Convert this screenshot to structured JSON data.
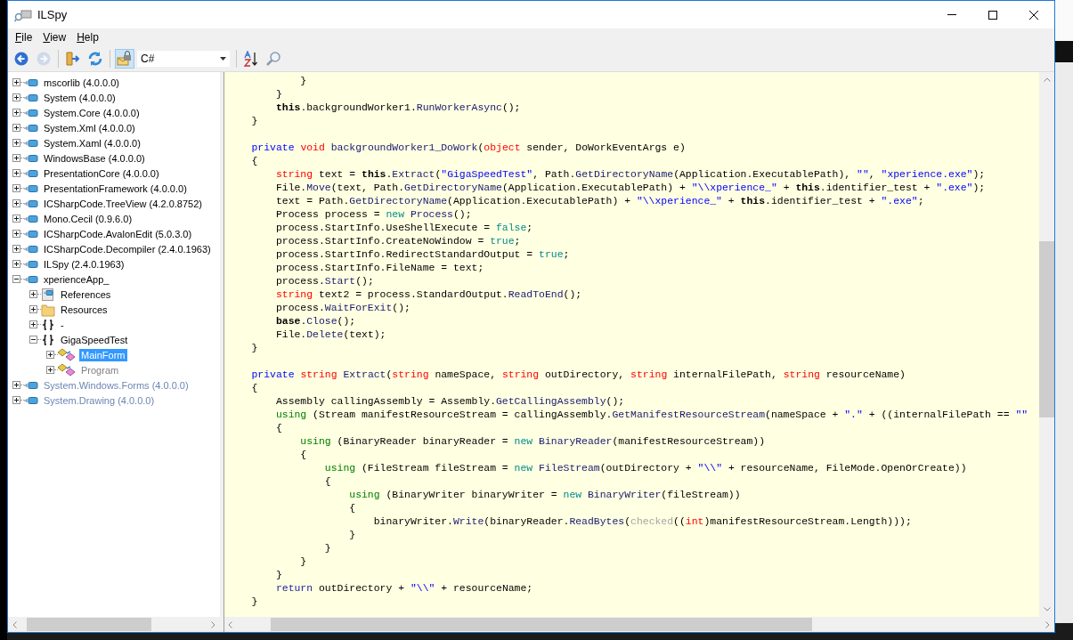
{
  "window": {
    "title": "ILSpy"
  },
  "menu": [
    {
      "label": "File"
    },
    {
      "label": "View"
    },
    {
      "label": "Help"
    }
  ],
  "toolbar": [
    {
      "kind": "back",
      "disabled": false
    },
    {
      "kind": "forward",
      "disabled": true
    },
    {
      "kind": "separator"
    },
    {
      "kind": "open",
      "disabled": false
    },
    {
      "kind": "reload",
      "disabled": false
    },
    {
      "kind": "separator"
    },
    {
      "kind": "lock",
      "disabled": false,
      "selected": true
    },
    {
      "kind": "language",
      "value": "C#"
    },
    {
      "kind": "separator"
    },
    {
      "kind": "sort",
      "disabled": false
    },
    {
      "kind": "search",
      "disabled": false
    }
  ],
  "tree": {
    "items": [
      {
        "kind": "assembly",
        "label": "mscorlib (4.0.0.0)",
        "expanded": false,
        "grayed": false,
        "selected": false
      },
      {
        "kind": "assembly",
        "label": "System (4.0.0.0)",
        "expanded": false,
        "grayed": false,
        "selected": false
      },
      {
        "kind": "assembly",
        "label": "System.Core (4.0.0.0)",
        "expanded": false,
        "grayed": false,
        "selected": false
      },
      {
        "kind": "assembly",
        "label": "System.Xml (4.0.0.0)",
        "expanded": false,
        "grayed": false,
        "selected": false
      },
      {
        "kind": "assembly",
        "label": "System.Xaml (4.0.0.0)",
        "expanded": false,
        "grayed": false,
        "selected": false
      },
      {
        "kind": "assembly",
        "label": "WindowsBase (4.0.0.0)",
        "expanded": false,
        "grayed": false,
        "selected": false
      },
      {
        "kind": "assembly",
        "label": "PresentationCore (4.0.0.0)",
        "expanded": false,
        "grayed": false,
        "selected": false
      },
      {
        "kind": "assembly",
        "label": "PresentationFramework (4.0.0.0)",
        "expanded": false,
        "grayed": false,
        "selected": false
      },
      {
        "kind": "assembly",
        "label": "ICSharpCode.TreeView (4.2.0.8752)",
        "expanded": false,
        "grayed": false,
        "selected": false
      },
      {
        "kind": "assembly",
        "label": "Mono.Cecil (0.9.6.0)",
        "expanded": false,
        "grayed": false,
        "selected": false
      },
      {
        "kind": "assembly",
        "label": "ICSharpCode.AvalonEdit (5.0.3.0)",
        "expanded": false,
        "grayed": false,
        "selected": false
      },
      {
        "kind": "assembly",
        "label": "ICSharpCode.Decompiler (2.4.0.1963)",
        "expanded": false,
        "grayed": false,
        "selected": false
      },
      {
        "kind": "assembly",
        "label": "ILSpy (2.4.0.1963)",
        "expanded": false,
        "grayed": false,
        "selected": false
      },
      {
        "kind": "assembly",
        "label": "xperienceApp_",
        "expanded": true,
        "grayed": false,
        "selected": false,
        "children": [
          {
            "kind": "references",
            "label": "References",
            "expanded": false,
            "grayed": false,
            "selected": false
          },
          {
            "kind": "folder",
            "label": "Resources",
            "expanded": false,
            "grayed": false,
            "selected": false
          },
          {
            "kind": "namespace",
            "label": "-",
            "expanded": false,
            "grayed": false,
            "selected": false
          },
          {
            "kind": "namespace",
            "label": "GigaSpeedTest",
            "expanded": true,
            "grayed": false,
            "selected": false,
            "children": [
              {
                "kind": "class",
                "label": "MainForm",
                "expanded": false,
                "grayed": false,
                "selected": true
              },
              {
                "kind": "class",
                "label": "Program",
                "expanded": false,
                "grayed": true,
                "selected": false
              }
            ]
          }
        ]
      },
      {
        "kind": "assembly",
        "label": "System.Windows.Forms (4.0.0.0)",
        "expanded": false,
        "grayed": true,
        "selected": false
      },
      {
        "kind": "assembly",
        "label": "System.Drawing (4.0.0.0)",
        "expanded": false,
        "grayed": true,
        "selected": false
      }
    ]
  },
  "code_lines": [
    {
      "kind": "code",
      "tokens": [
        {
          "kind": "plain",
          "text": "            }"
        }
      ]
    },
    {
      "kind": "code",
      "tokens": [
        {
          "kind": "plain",
          "text": "        }"
        }
      ]
    },
    {
      "kind": "code",
      "tokens": [
        {
          "kind": "bold",
          "text": "        this"
        },
        {
          "kind": "plain",
          "text": ".backgroundWorker1."
        },
        {
          "kind": "method",
          "text": "RunWorkerAsync"
        },
        {
          "kind": "plain",
          "text": "();"
        }
      ]
    },
    {
      "kind": "code",
      "tokens": [
        {
          "kind": "plain",
          "text": "    }"
        }
      ]
    },
    {
      "kind": "blank"
    },
    {
      "kind": "code",
      "tokens": [
        {
          "kind": "keyword",
          "text": "    private "
        },
        {
          "kind": "type",
          "text": "void "
        },
        {
          "kind": "method",
          "text": "backgroundWorker1_DoWork"
        },
        {
          "kind": "plain",
          "text": "("
        },
        {
          "kind": "type",
          "text": "object"
        },
        {
          "kind": "plain",
          "text": " sender, DoWorkEventArgs e)"
        }
      ]
    },
    {
      "kind": "code",
      "tokens": [
        {
          "kind": "plain",
          "text": "    {"
        }
      ]
    },
    {
      "kind": "code",
      "tokens": [
        {
          "kind": "type",
          "text": "        string"
        },
        {
          "kind": "plain",
          "text": " text = "
        },
        {
          "kind": "bold",
          "text": "this"
        },
        {
          "kind": "plain",
          "text": "."
        },
        {
          "kind": "method",
          "text": "Extract"
        },
        {
          "kind": "plain",
          "text": "("
        },
        {
          "kind": "string",
          "text": "\"GigaSpeedTest\""
        },
        {
          "kind": "plain",
          "text": ", Path."
        },
        {
          "kind": "method",
          "text": "GetDirectoryName"
        },
        {
          "kind": "plain",
          "text": "(Application.ExecutablePath), "
        },
        {
          "kind": "string",
          "text": "\"\""
        },
        {
          "kind": "plain",
          "text": ", "
        },
        {
          "kind": "string",
          "text": "\"xperience.exe\""
        },
        {
          "kind": "plain",
          "text": ");"
        }
      ]
    },
    {
      "kind": "code",
      "tokens": [
        {
          "kind": "plain",
          "text": "        File."
        },
        {
          "kind": "method",
          "text": "Move"
        },
        {
          "kind": "plain",
          "text": "(text, Path."
        },
        {
          "kind": "method",
          "text": "GetDirectoryName"
        },
        {
          "kind": "plain",
          "text": "(Application.ExecutablePath) + "
        },
        {
          "kind": "string",
          "text": "\"\\\\xperience_\""
        },
        {
          "kind": "plain",
          "text": " + "
        },
        {
          "kind": "bold",
          "text": "this"
        },
        {
          "kind": "plain",
          "text": ".identifier_test + "
        },
        {
          "kind": "string",
          "text": "\".exe\""
        },
        {
          "kind": "plain",
          "text": ");"
        }
      ]
    },
    {
      "kind": "code",
      "tokens": [
        {
          "kind": "plain",
          "text": "        text = Path."
        },
        {
          "kind": "method",
          "text": "GetDirectoryName"
        },
        {
          "kind": "plain",
          "text": "(Application.ExecutablePath) + "
        },
        {
          "kind": "string",
          "text": "\"\\\\xperience_\""
        },
        {
          "kind": "plain",
          "text": " + "
        },
        {
          "kind": "bold",
          "text": "this"
        },
        {
          "kind": "plain",
          "text": ".identifier_test + "
        },
        {
          "kind": "string",
          "text": "\".exe\""
        },
        {
          "kind": "plain",
          "text": ";"
        }
      ]
    },
    {
      "kind": "code",
      "tokens": [
        {
          "kind": "plain",
          "text": "        Process process = "
        },
        {
          "kind": "literal",
          "text": "new "
        },
        {
          "kind": "method",
          "text": "Process"
        },
        {
          "kind": "plain",
          "text": "();"
        }
      ]
    },
    {
      "kind": "code",
      "tokens": [
        {
          "kind": "plain",
          "text": "        process.StartInfo.UseShellExecute = "
        },
        {
          "kind": "literal",
          "text": "false"
        },
        {
          "kind": "plain",
          "text": ";"
        }
      ]
    },
    {
      "kind": "code",
      "tokens": [
        {
          "kind": "plain",
          "text": "        process.StartInfo.CreateNoWindow = "
        },
        {
          "kind": "literal",
          "text": "true"
        },
        {
          "kind": "plain",
          "text": ";"
        }
      ]
    },
    {
      "kind": "code",
      "tokens": [
        {
          "kind": "plain",
          "text": "        process.StartInfo.RedirectStandardOutput = "
        },
        {
          "kind": "literal",
          "text": "true"
        },
        {
          "kind": "plain",
          "text": ";"
        }
      ]
    },
    {
      "kind": "code",
      "tokens": [
        {
          "kind": "plain",
          "text": "        process.StartInfo.FileName = text;"
        }
      ]
    },
    {
      "kind": "code",
      "tokens": [
        {
          "kind": "plain",
          "text": "        process."
        },
        {
          "kind": "method",
          "text": "Start"
        },
        {
          "kind": "plain",
          "text": "();"
        }
      ]
    },
    {
      "kind": "code",
      "tokens": [
        {
          "kind": "type",
          "text": "        string"
        },
        {
          "kind": "plain",
          "text": " text2 = process.StandardOutput."
        },
        {
          "kind": "method",
          "text": "ReadToEnd"
        },
        {
          "kind": "plain",
          "text": "();"
        }
      ]
    },
    {
      "kind": "code",
      "tokens": [
        {
          "kind": "plain",
          "text": "        process."
        },
        {
          "kind": "method",
          "text": "WaitForExit"
        },
        {
          "kind": "plain",
          "text": "();"
        }
      ]
    },
    {
      "kind": "code",
      "tokens": [
        {
          "kind": "bold",
          "text": "        base"
        },
        {
          "kind": "plain",
          "text": "."
        },
        {
          "kind": "method",
          "text": "Close"
        },
        {
          "kind": "plain",
          "text": "();"
        }
      ]
    },
    {
      "kind": "code",
      "tokens": [
        {
          "kind": "plain",
          "text": "        File."
        },
        {
          "kind": "method",
          "text": "Delete"
        },
        {
          "kind": "plain",
          "text": "(text);"
        }
      ]
    },
    {
      "kind": "code",
      "tokens": [
        {
          "kind": "plain",
          "text": "    }"
        }
      ]
    },
    {
      "kind": "blank"
    },
    {
      "kind": "code",
      "tokens": [
        {
          "kind": "keyword",
          "text": "    private "
        },
        {
          "kind": "type",
          "text": "string "
        },
        {
          "kind": "method",
          "text": "Extract"
        },
        {
          "kind": "plain",
          "text": "("
        },
        {
          "kind": "type",
          "text": "string"
        },
        {
          "kind": "plain",
          "text": " nameSpace, "
        },
        {
          "kind": "type",
          "text": "string"
        },
        {
          "kind": "plain",
          "text": " outDirectory, "
        },
        {
          "kind": "type",
          "text": "string"
        },
        {
          "kind": "plain",
          "text": " internalFilePath, "
        },
        {
          "kind": "type",
          "text": "string"
        },
        {
          "kind": "plain",
          "text": " resourceName)"
        }
      ]
    },
    {
      "kind": "code",
      "tokens": [
        {
          "kind": "plain",
          "text": "    {"
        }
      ]
    },
    {
      "kind": "code",
      "tokens": [
        {
          "kind": "plain",
          "text": "        Assembly callingAssembly = Assembly."
        },
        {
          "kind": "method",
          "text": "GetCallingAssembly"
        },
        {
          "kind": "plain",
          "text": "();"
        }
      ]
    },
    {
      "kind": "code",
      "tokens": [
        {
          "kind": "using",
          "text": "        using"
        },
        {
          "kind": "plain",
          "text": " (Stream manifestResourceStream = callingAssembly."
        },
        {
          "kind": "method",
          "text": "GetManifestResourceStream"
        },
        {
          "kind": "plain",
          "text": "(nameSpace + "
        },
        {
          "kind": "string",
          "text": "\".\""
        },
        {
          "kind": "plain",
          "text": " + ((internalFilePath == "
        },
        {
          "kind": "string",
          "text": "\"\""
        }
      ]
    },
    {
      "kind": "code",
      "tokens": [
        {
          "kind": "plain",
          "text": "        {"
        }
      ]
    },
    {
      "kind": "code",
      "tokens": [
        {
          "kind": "using",
          "text": "            using"
        },
        {
          "kind": "plain",
          "text": " (BinaryReader binaryReader = "
        },
        {
          "kind": "literal",
          "text": "new "
        },
        {
          "kind": "method",
          "text": "BinaryReader"
        },
        {
          "kind": "plain",
          "text": "(manifestResourceStream))"
        }
      ]
    },
    {
      "kind": "code",
      "tokens": [
        {
          "kind": "plain",
          "text": "            {"
        }
      ]
    },
    {
      "kind": "code",
      "tokens": [
        {
          "kind": "using",
          "text": "                using"
        },
        {
          "kind": "plain",
          "text": " (FileStream fileStream = "
        },
        {
          "kind": "literal",
          "text": "new "
        },
        {
          "kind": "method",
          "text": "FileStream"
        },
        {
          "kind": "plain",
          "text": "(outDirectory + "
        },
        {
          "kind": "string",
          "text": "\"\\\\\""
        },
        {
          "kind": "plain",
          "text": " + resourceName, FileMode.OpenOrCreate))"
        }
      ]
    },
    {
      "kind": "code",
      "tokens": [
        {
          "kind": "plain",
          "text": "                {"
        }
      ]
    },
    {
      "kind": "code",
      "tokens": [
        {
          "kind": "using",
          "text": "                    using"
        },
        {
          "kind": "plain",
          "text": " (BinaryWriter binaryWriter = "
        },
        {
          "kind": "literal",
          "text": "new "
        },
        {
          "kind": "method",
          "text": "BinaryWriter"
        },
        {
          "kind": "plain",
          "text": "(fileStream))"
        }
      ]
    },
    {
      "kind": "code",
      "tokens": [
        {
          "kind": "plain",
          "text": "                    {"
        }
      ]
    },
    {
      "kind": "code",
      "tokens": [
        {
          "kind": "plain",
          "text": "                        binaryWriter."
        },
        {
          "kind": "method",
          "text": "Write"
        },
        {
          "kind": "plain",
          "text": "(binaryReader."
        },
        {
          "kind": "method",
          "text": "ReadBytes"
        },
        {
          "kind": "plain",
          "text": "("
        },
        {
          "kind": "dim",
          "text": "checked"
        },
        {
          "kind": "plain",
          "text": "(("
        },
        {
          "kind": "type",
          "text": "int"
        },
        {
          "kind": "plain",
          "text": ")manifestResourceStream.Length)));"
        }
      ]
    },
    {
      "kind": "code",
      "tokens": [
        {
          "kind": "plain",
          "text": "                    }"
        }
      ]
    },
    {
      "kind": "code",
      "tokens": [
        {
          "kind": "plain",
          "text": "                }"
        }
      ]
    },
    {
      "kind": "code",
      "tokens": [
        {
          "kind": "plain",
          "text": "            }"
        }
      ]
    },
    {
      "kind": "code",
      "tokens": [
        {
          "kind": "plain",
          "text": "        }"
        }
      ]
    },
    {
      "kind": "code",
      "tokens": [
        {
          "kind": "control",
          "text": "        return"
        },
        {
          "kind": "plain",
          "text": " outDirectory + "
        },
        {
          "kind": "string",
          "text": "\"\\\\\""
        },
        {
          "kind": "plain",
          "text": " + resourceName;"
        }
      ]
    },
    {
      "kind": "code",
      "tokens": [
        {
          "kind": "plain",
          "text": "    }"
        }
      ]
    }
  ]
}
